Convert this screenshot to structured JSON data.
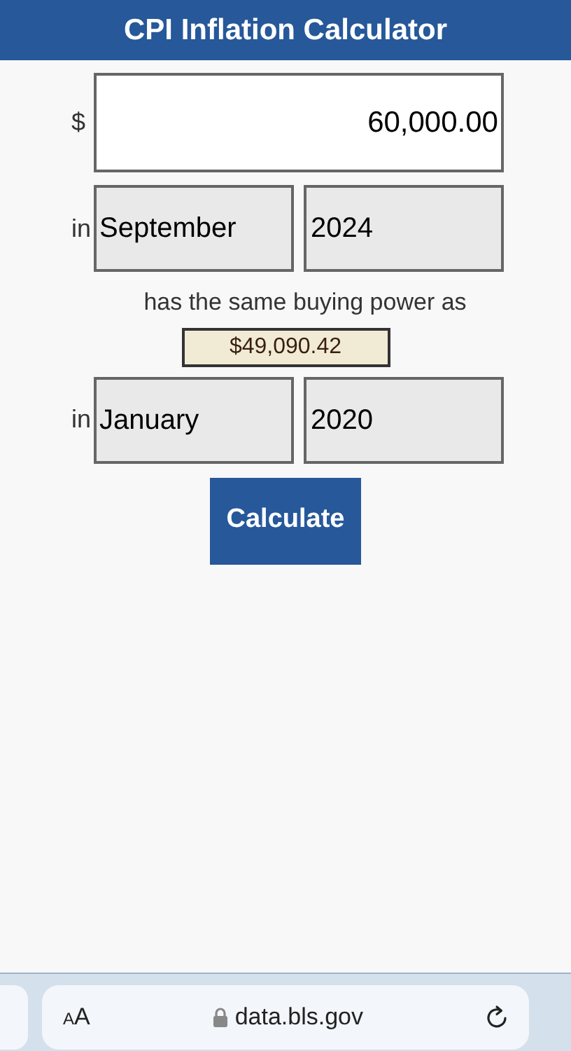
{
  "header": {
    "title": "CPI Inflation Calculator"
  },
  "amount": {
    "currency": "$",
    "value": "60,000.00"
  },
  "from": {
    "prefix": "in",
    "month": "September",
    "year": "2024"
  },
  "middle_text": "has the same buying power as",
  "result": "$49,090.42",
  "to": {
    "prefix": "in",
    "month": "January",
    "year": "2020"
  },
  "calculate_button": "Calculate",
  "browser_bar": {
    "text_size_button": "AA",
    "url": "data.bls.gov"
  }
}
